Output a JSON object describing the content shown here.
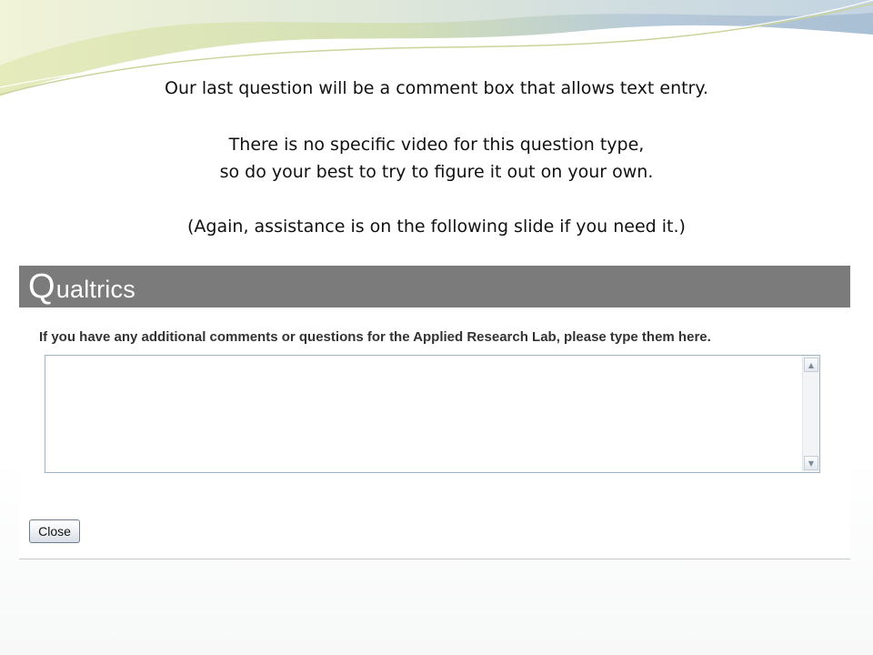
{
  "slide": {
    "lines": [
      "Our last question will be a comment box that allows text entry.",
      "There is no specific video for this question type,",
      "so do your best to try to figure it out on your own.",
      "(Again, assistance is on the following slide if you need it.)"
    ]
  },
  "qualtrics": {
    "logo_q": "Q",
    "logo_rest": "ualtrics",
    "question": "If you have any additional comments or questions for the Applied Research Lab, please type them here.",
    "textbox_value": "",
    "close_label": "Close",
    "header_color": "#7b7b7b"
  }
}
